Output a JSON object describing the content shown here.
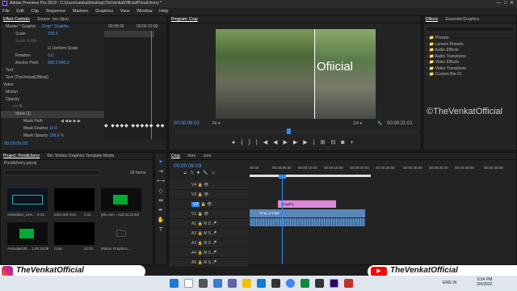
{
  "app": {
    "title": "Adobe Premiere Pro 2019 - C:\\Users\\venka\\Desktop\\TheVenkatOfficial\\Pondicherry *"
  },
  "menu": [
    "File",
    "Edit",
    "Clip",
    "Sequence",
    "Markers",
    "Graphics",
    "View",
    "Window",
    "Help"
  ],
  "effect_controls": {
    "tabs": [
      "Effect Controls",
      "Source: (no clips)"
    ],
    "master_label": "Master * Graphic",
    "clip_label": "Crop * Graphic",
    "timecodes": [
      "00:05:00",
      "00:00:10:00"
    ],
    "rows": [
      {
        "label": "Scale",
        "value": "100.0"
      },
      {
        "label": "Scale Width",
        "value": ""
      },
      {
        "label": "",
        "value": "Uniform Scale"
      },
      {
        "label": "Rotation",
        "value": "0.0"
      },
      {
        "label": "Anchor Point",
        "value": "960.0   540.0"
      },
      {
        "label": "Text",
        "value": ""
      },
      {
        "label": "Text (TheVenkatOfficial)",
        "value": ""
      },
      {
        "label": "Video",
        "value": ""
      },
      {
        "label": "Motion",
        "value": ""
      },
      {
        "label": "Opacity",
        "value": ""
      },
      {
        "label": "Mask (1)",
        "value": ""
      },
      {
        "label": "Mask Path",
        "value": ""
      },
      {
        "label": "Mask Feather",
        "value": "10.0"
      },
      {
        "label": "Mask Opacity",
        "value": "100.0 %"
      }
    ],
    "current_time": "00:00:06:03"
  },
  "program": {
    "tab": "Program: Crop",
    "overlay_text": "Ofiicial",
    "timecode_left": "00:00:06:03",
    "fit_label": "Fit",
    "quality": "1/4",
    "timecode_right": "00:00:21:01"
  },
  "effects": {
    "tabs": [
      "Effects",
      "Essential Graphics"
    ],
    "items": [
      "Presets",
      "Lumetri Presets",
      "Audio Effects",
      "Audio Transitions",
      "Video Effects",
      "Video Transitions",
      "Custom Bin 01"
    ]
  },
  "watermark": "©TheVenkatOfficial",
  "project": {
    "tabs": [
      "Project: Pondicherry",
      "Bin: Motion Graphics Template Media"
    ],
    "file": "Pondicherry.prproj",
    "item_count": "24 Items",
    "thumbs": [
      {
        "label": "Animation_Line...",
        "dur": "4:13"
      },
      {
        "label": "Intro text mov",
        "dur": "4:21"
      },
      {
        "label": "ytfx.com - Au...",
        "dur": "2:11:22:53"
      },
      {
        "label": "Animated Bl...",
        "dur": "1:49:19:08"
      },
      {
        "label": "Crop",
        "dur": "21:01"
      },
      {
        "label": "Motion Graphics ...",
        "dur": ""
      }
    ]
  },
  "timeline": {
    "tabs": [
      "Crop",
      "Intro",
      "core"
    ],
    "timecode": "00:00:06:03",
    "ruler": [
      "00:00",
      "00:00:05:00",
      "00:00:10:00",
      "00:00:15:00",
      "00:00:20:00",
      "00:00:25:00",
      "00:00:30:00",
      "00:00:35:00",
      "00:00:40:00",
      "00:00:45:00"
    ],
    "video_tracks": [
      "V4",
      "V3",
      "V2",
      "V1"
    ],
    "audio_tracks": [
      "A1",
      "A2",
      "A3",
      "A4",
      "A5"
    ],
    "clips": {
      "graphic": "Graphic",
      "video": "Crop_2.mp4"
    }
  },
  "socials": {
    "instagram": "TheVenkatOfficial",
    "youtube": "TheVenkatOfficial"
  },
  "taskbar": {
    "time": "6:54 PM",
    "date": "3/4/2022",
    "lang": "ENG IN"
  },
  "colors": {
    "accent": "#2d8ceb",
    "graphic_clip": "#d98bd9",
    "video_clip": "#5a87b8",
    "instagram": "#d62976",
    "youtube": "#ff0000"
  }
}
